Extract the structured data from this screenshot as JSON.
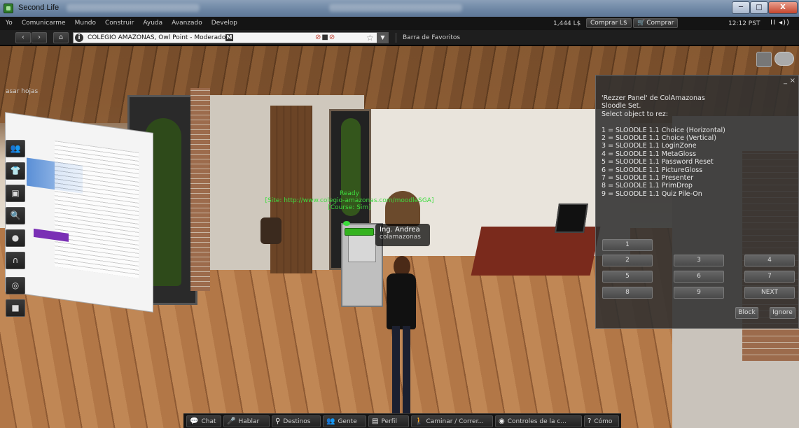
{
  "window": {
    "title": "Second Life",
    "controls": {
      "minimize": "─",
      "maximize": "□",
      "close": "X"
    }
  },
  "menubar": {
    "items": [
      "Yo",
      "Comunicarme",
      "Mundo",
      "Construir",
      "Ayuda",
      "Avanzado",
      "Develop"
    ],
    "balance": "1,444 L$",
    "buy_lindens": "Comprar L$",
    "buy": "Comprar",
    "clock": "12:12 PST",
    "media": "II ◂))"
  },
  "navbar": {
    "back": "‹",
    "forward": "›",
    "home": "⌂",
    "location": "COLEGIO AMAZONAS, Owl Point - Moderado",
    "maturity": "M",
    "favorites": "Barra de Favoritos"
  },
  "scene": {
    "side_text": "asar hojas",
    "overhead_text": [
      "Ready",
      "[Site: http://www.colegio-amazonas.com/moodleSGA]",
      "[Course: Sim]"
    ],
    "avatar_name": "Ing. Andrea",
    "avatar_group": "colamazonas"
  },
  "left_toolbar": [
    {
      "icon": "people-icon",
      "glyph": "👥"
    },
    {
      "icon": "shirt-icon",
      "glyph": "👕"
    },
    {
      "icon": "inventory-icon",
      "glyph": "▣"
    },
    {
      "icon": "search-icon",
      "glyph": "🔍"
    },
    {
      "icon": "landmark-icon",
      "glyph": "●"
    },
    {
      "icon": "headset-icon",
      "glyph": "∩"
    },
    {
      "icon": "radar-icon",
      "glyph": "◎"
    },
    {
      "icon": "camera-icon",
      "glyph": "■"
    }
  ],
  "dialog": {
    "message": "'Rezzer Panel' de ColAmazonas\nSloodle Set.\nSelect object to rez:\n\n1 = SLOODLE 1.1 Choice (Horizontal)\n2 = SLOODLE 1.1 Choice (Vertical)\n3 = SLOODLE 1.1 LoginZone\n4 = SLOODLE 1.1 MetaGloss\n5 = SLOODLE 1.1 Password Reset\n6 = SLOODLE 1.1 PictureGloss\n7 = SLOODLE 1.1 Presenter\n8 = SLOODLE 1.1 PrimDrop\n9 = SLOODLE 1.1 Quiz Pile-On",
    "minimize": "_",
    "close": "×",
    "buttons": [
      "1",
      "2",
      "3",
      "4",
      "5",
      "6",
      "7",
      "8",
      "9",
      "NEXT"
    ],
    "block": "Block",
    "ignore": "Ignore"
  },
  "bottombar": [
    {
      "label": "Chat",
      "icon": "chat-icon",
      "glyph": "💬"
    },
    {
      "label": "Hablar",
      "icon": "microphone-icon",
      "glyph": "🎤"
    },
    {
      "label": "Destinos",
      "icon": "location-pin-icon",
      "glyph": "⚲"
    },
    {
      "label": "Gente",
      "icon": "people-icon",
      "glyph": "👥"
    },
    {
      "label": "Perfil",
      "icon": "profile-icon",
      "glyph": "▤"
    },
    {
      "label": "Caminar / Correr...",
      "icon": "walk-icon",
      "glyph": "🚶"
    },
    {
      "label": "Controles de la c...",
      "icon": "eye-icon",
      "glyph": "◉"
    },
    {
      "label": "Cómo",
      "icon": "help-icon",
      "glyph": "?"
    }
  ]
}
